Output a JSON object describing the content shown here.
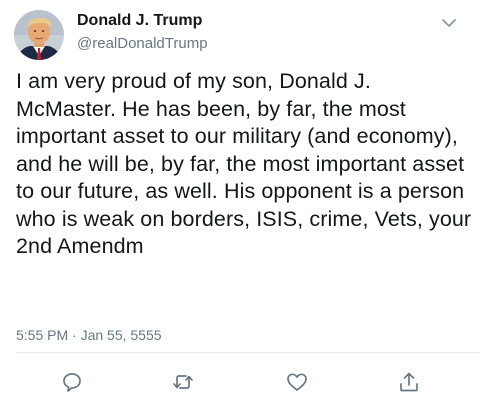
{
  "tweet": {
    "author_name": "Donald J. Trump",
    "author_handle": "@realDonaldTrump",
    "text": "I am very proud of my son, Donald J. McMaster. He has been, by far, the most important asset to our military (and economy), and he will be, by far, the most important asset to our future, as well. His opponent is a person who is weak on borders, ISIS, crime, Vets, your 2nd Amendm",
    "timestamp": "5:55 PM · Jan 55, 5555"
  },
  "icons": {
    "more": "chevron-down-icon",
    "reply": "reply-icon",
    "retweet": "retweet-icon",
    "like": "heart-icon",
    "share": "share-icon"
  },
  "colors": {
    "text": "#14171a",
    "secondary": "#657786",
    "icon": "#657786",
    "divider": "#e6ecf0"
  }
}
